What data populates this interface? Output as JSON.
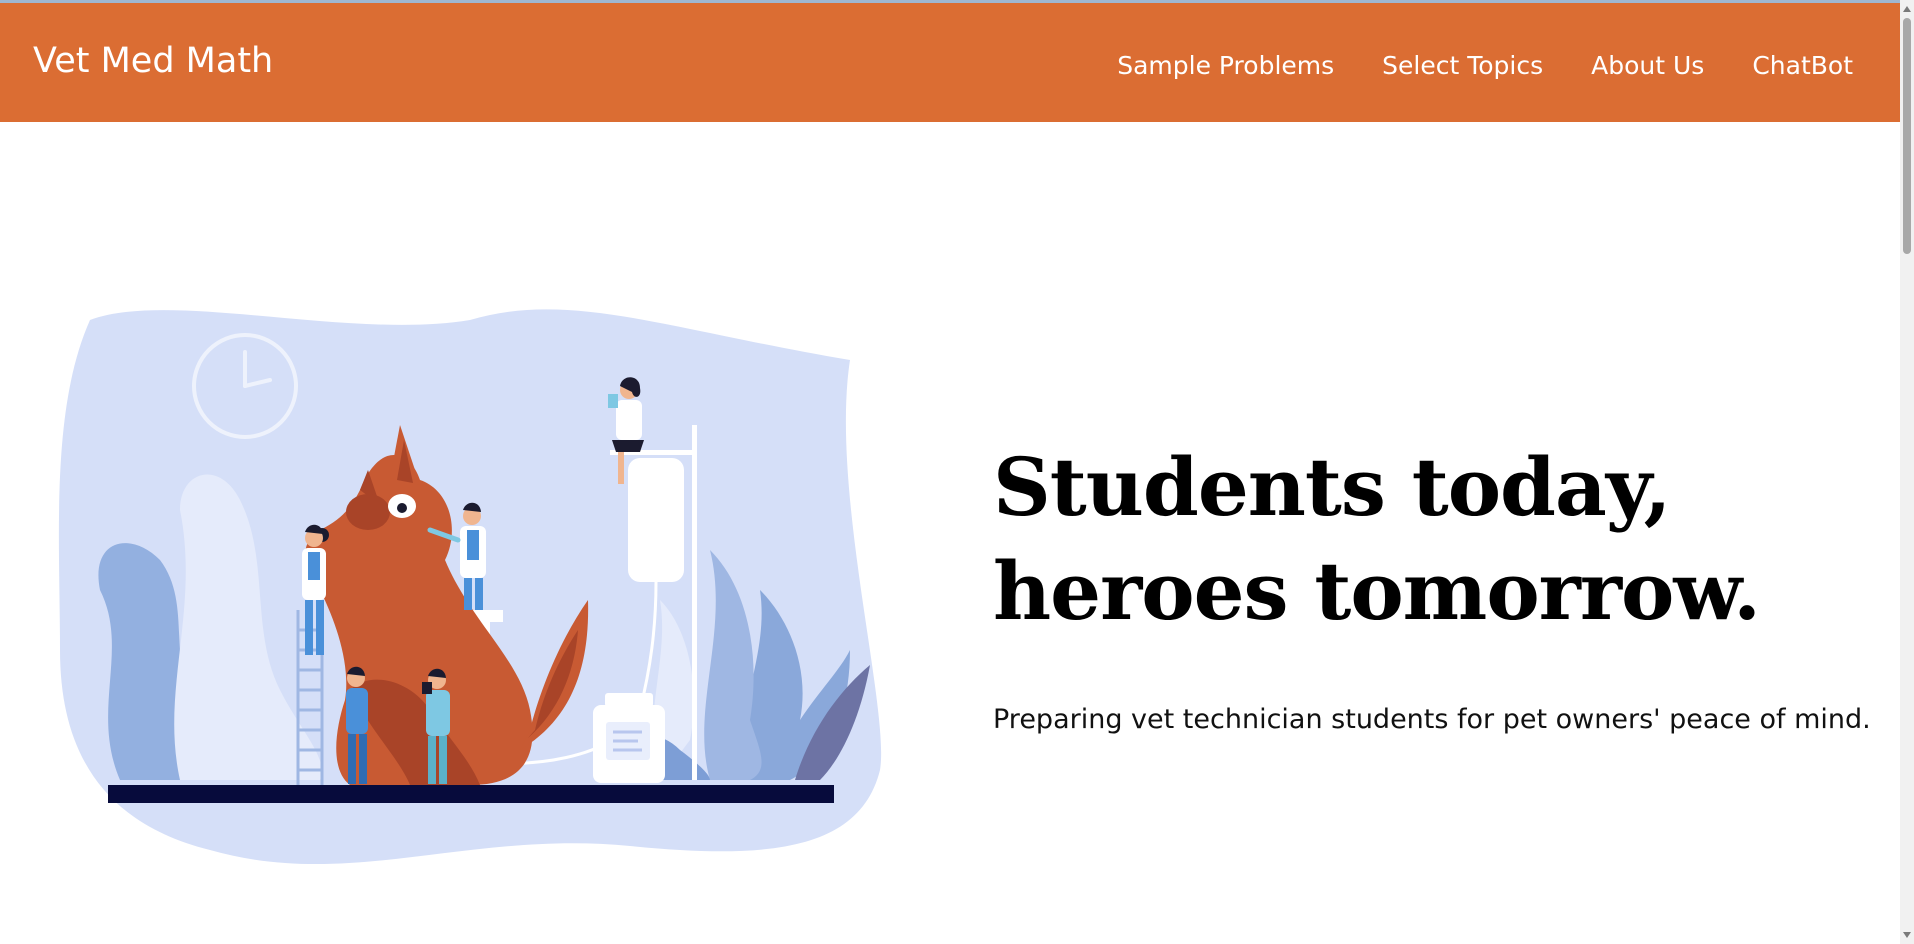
{
  "nav": {
    "brand": "Vet Med Math",
    "links": [
      {
        "label": "Sample Problems"
      },
      {
        "label": "Select Topics"
      },
      {
        "label": "About Us"
      },
      {
        "label": "ChatBot"
      }
    ]
  },
  "hero": {
    "headline_line1": "Students today,",
    "headline_line2": "heroes tomorrow.",
    "tagline": "Preparing vet technician students for pet owners' peace of mind."
  },
  "colors": {
    "navbar": "#db6d33",
    "blob": "#d5dff8",
    "dog": "#c85a33",
    "floor": "#070b3c"
  }
}
